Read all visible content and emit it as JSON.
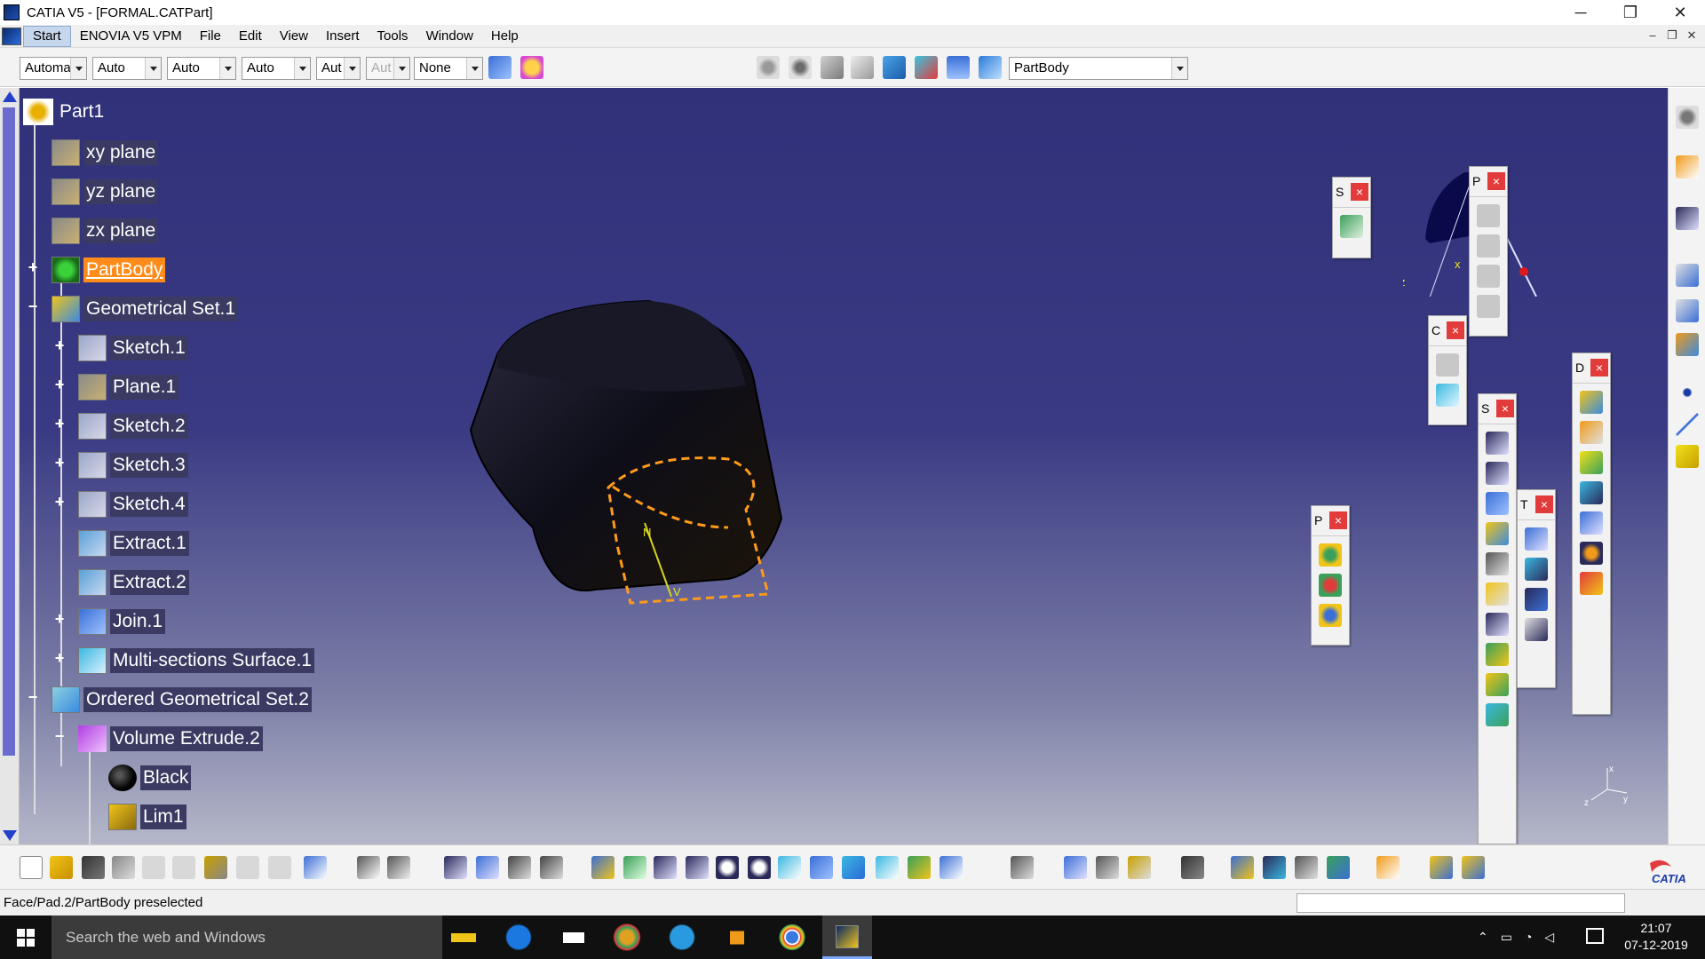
{
  "window": {
    "title": "CATIA V5 - [FORMAL.CATPart]",
    "minimize": "─",
    "restore": "❐",
    "close": "✕"
  },
  "menu": {
    "items": [
      "Start",
      "ENOVIA V5 VPM",
      "File",
      "Edit",
      "View",
      "Insert",
      "Tools",
      "Window",
      "Help"
    ],
    "mdi_minimize": "–",
    "mdi_restore": "❐",
    "mdi_close": "✕"
  },
  "toolbar": {
    "combos": [
      "Automa",
      "Auto",
      "Auto",
      "Auto",
      "Aut",
      "Aut",
      "None"
    ],
    "current_body": "PartBody"
  },
  "tree": {
    "root": "Part1",
    "nodes": [
      {
        "label": "xy plane",
        "icon": "plane-icon"
      },
      {
        "label": "yz plane",
        "icon": "plane-icon"
      },
      {
        "label": "zx plane",
        "icon": "plane-icon"
      },
      {
        "label": "PartBody",
        "icon": "partbody-icon",
        "expander": "+",
        "selected": true
      },
      {
        "label": "Geometrical Set.1",
        "icon": "geometrical-set-icon",
        "expander": "−"
      },
      {
        "label": "Sketch.1",
        "icon": "sketch-icon",
        "expander": "+"
      },
      {
        "label": "Plane.1",
        "icon": "plane-icon",
        "expander": "+"
      },
      {
        "label": "Sketch.2",
        "icon": "sketch-icon",
        "expander": "+"
      },
      {
        "label": "Sketch.3",
        "icon": "sketch-icon",
        "expander": "+"
      },
      {
        "label": "Sketch.4",
        "icon": "sketch-icon",
        "expander": "+"
      },
      {
        "label": "Extract.1",
        "icon": "extract-icon"
      },
      {
        "label": "Extract.2",
        "icon": "extract-icon"
      },
      {
        "label": "Join.1",
        "icon": "join-icon",
        "expander": "+"
      },
      {
        "label": "Multi-sections Surface.1",
        "icon": "multi-sections-surface-icon",
        "expander": "+"
      },
      {
        "label": "Ordered Geometrical Set.2",
        "icon": "ordered-geometrical-set-icon",
        "expander": "−"
      },
      {
        "label": "Volume Extrude.2",
        "icon": "volume-extrude-icon",
        "expander": "−"
      },
      {
        "label": "Black",
        "icon": "black-material-icon"
      },
      {
        "label": "Lim1",
        "icon": "limit-icon"
      }
    ]
  },
  "compass": {
    "x_label": "x",
    "z_label": "z"
  },
  "model": {
    "v_label": "V",
    "n_label": "N"
  },
  "axis": {
    "x": "x",
    "y": "y",
    "z": "z"
  },
  "floating_toolbars": [
    {
      "title": "S",
      "close": "×"
    },
    {
      "title": "P",
      "close": "×"
    },
    {
      "title": "C",
      "close": "×"
    },
    {
      "title": "S",
      "close": "×"
    },
    {
      "title": "D",
      "close": "×"
    },
    {
      "title": "T",
      "close": "×"
    },
    {
      "title": "P",
      "close": "×"
    }
  ],
  "status": {
    "message": "Face/Pad.2/PartBody preselected"
  },
  "brand": {
    "logo_text": "CATIA"
  },
  "taskbar": {
    "search_placeholder": "Search the web and Windows",
    "time": "21:07",
    "date": "07-12-2019"
  },
  "colors": {
    "selection": "#ff8c1a",
    "viewport_top": "#31317a",
    "viewport_bottom": "#b5b7c9",
    "close_red": "#e23b3b"
  }
}
